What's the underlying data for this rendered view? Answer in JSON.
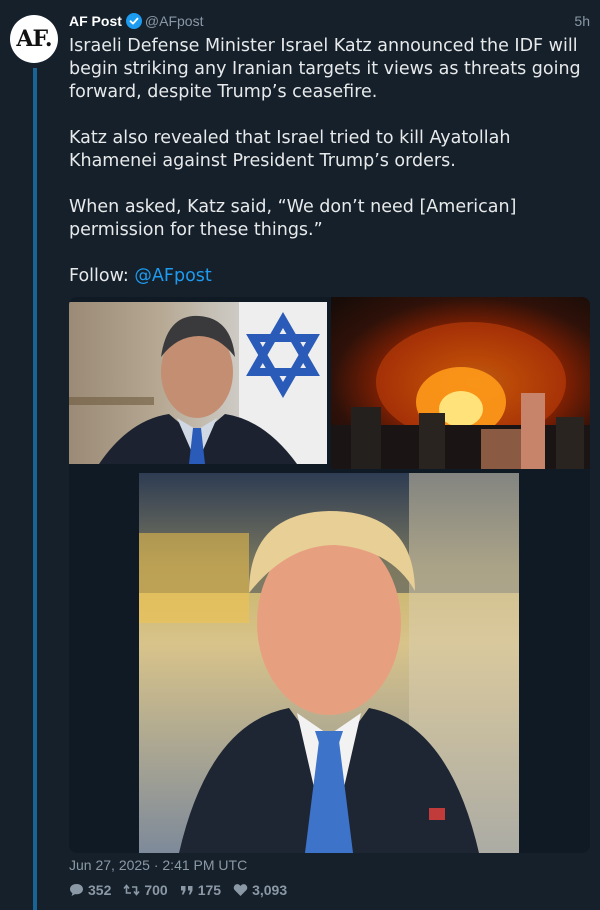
{
  "avatar": {
    "text": "AF."
  },
  "header": {
    "name": "AF Post",
    "handle": "@AFpost",
    "time": "5h",
    "verified": true
  },
  "tweet": {
    "paragraphs": [
      "Israeli Defense Minister Israel Katz announced the IDF will begin striking any Iranian targets it views as threats going forward, despite Trump’s ceasefire.",
      "Katz also revealed that Israel tried to kill Ayatollah Khamenei against President Trump’s orders.",
      "When asked, Katz said, “We don’t need [American] permission for these things.”"
    ],
    "follow_label": "Follow:",
    "follow_mention": "@AFpost"
  },
  "footer": {
    "date": "Jun 27, 2025 · 2:41 PM UTC",
    "replies": "352",
    "retweets": "700",
    "quotes": "175",
    "likes": "3,093"
  },
  "colors": {
    "background": "#15202b",
    "accent": "#1d9bf0",
    "muted": "#8b98a5",
    "text": "#e7e9ea"
  },
  "icons": {
    "reply": "speech-bubble-icon",
    "retweet": "retweet-icon",
    "quote": "quote-icon",
    "like": "heart-icon",
    "verified": "verified-badge-icon"
  }
}
